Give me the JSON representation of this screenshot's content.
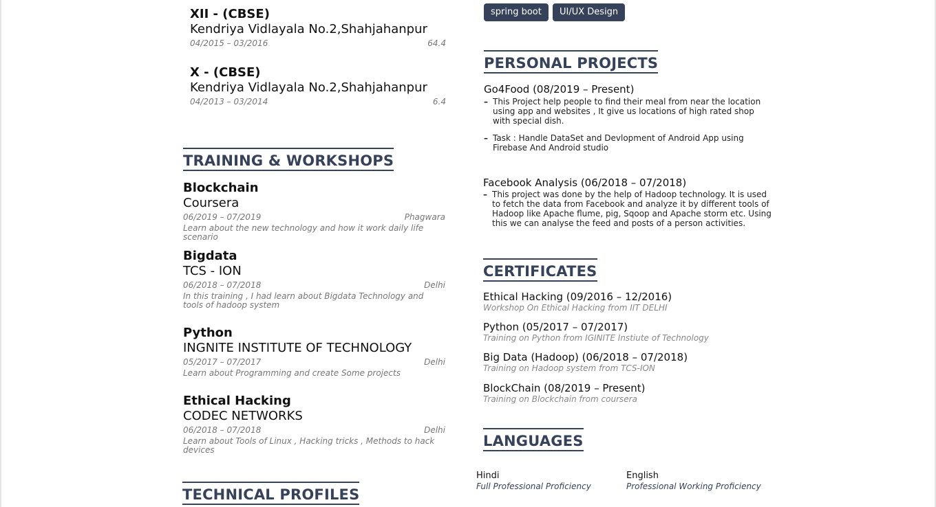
{
  "education": [
    {
      "title": "XII - (CBSE)",
      "school": "Kendriya Vidlayala No.2,Shahjahanpur",
      "dates": "04/2015 – 03/2016",
      "score": "64.4"
    },
    {
      "title": "X - (CBSE)",
      "school": "Kendriya Vidlayala No.2,Shahjahanpur",
      "dates": "04/2013 – 03/2014",
      "score": "6.4"
    }
  ],
  "training": {
    "heading": "TRAINING & WORKSHOPS",
    "items": [
      {
        "title": "Blockchain",
        "org": "Coursera",
        "dates": "06/2019 – 07/2019",
        "location": "Phagwara",
        "desc": "Learn about the new technology and how it work daily life scenario"
      },
      {
        "title": "Bigdata",
        "org": "TCS - ION",
        "dates": "06/2018 – 07/2018",
        "location": "Delhi",
        "desc": "In this training , I had learn about Bigdata Technology and tools of hadoop system"
      },
      {
        "title": "Python",
        "org": "INGNITE INSTITUTE OF TECHNOLOGY",
        "dates": "05/2017 – 07/2017",
        "location": "Delhi",
        "desc": "Learn about Programming and create Some projects"
      },
      {
        "title": "Ethical Hacking",
        "org": "CODEC NETWORKS",
        "dates": "06/2018 – 07/2018",
        "location": "Delhi",
        "desc": "Learn about Tools of Linux , Hacking tricks , Methods to hack devices"
      }
    ]
  },
  "technical_profiles": {
    "heading": "TECHNICAL PROFILES"
  },
  "skills": {
    "tags": [
      "spring boot",
      "UI/UX Design"
    ]
  },
  "projects": {
    "heading": "PERSONAL PROJECTS",
    "items": [
      {
        "title": "Go4Food (08/2019 – Present)",
        "bullets": [
          "This Project help people to find their meal from near the location using app and websites , It give us locations of high rated shop with special dish.",
          "Task : Handle DataSet and Devlopment of Android App using Firebase And Android studio"
        ]
      },
      {
        "title": "Facebook Analysis (06/2018 – 07/2018)",
        "bullets": [
          "This project was done by the help of Hadoop technology. It is used to fetch the data from Facebook and analyze it by different tools of Hadoop like Apache flume, pig, Sqoop and Apache storm etc. Using this we can analyse the feed and posts of a person activities."
        ]
      }
    ]
  },
  "certificates": {
    "heading": "CERTIFICATES",
    "items": [
      {
        "title": "Ethical Hacking (09/2016 – 12/2016)",
        "desc": "Workshop On Ethical Hacking from IIT DELHI"
      },
      {
        "title": "Python (05/2017 – 07/2017)",
        "desc": "Training on Python from IGINITE Instiute of Technology"
      },
      {
        "title": "Big Data (Hadoop) (06/2018 – 07/2018)",
        "desc": "Training on Hadoop system from TCS-ION"
      },
      {
        "title": "BlockChain (08/2019 – Present)",
        "desc": "Training on Blockchain from coursera"
      }
    ]
  },
  "languages": {
    "heading": "LANGUAGES",
    "items": [
      {
        "name": "Hindi",
        "level": "Full Professional Proficiency"
      },
      {
        "name": "English",
        "level": "Professional Working Proficiency"
      }
    ]
  }
}
